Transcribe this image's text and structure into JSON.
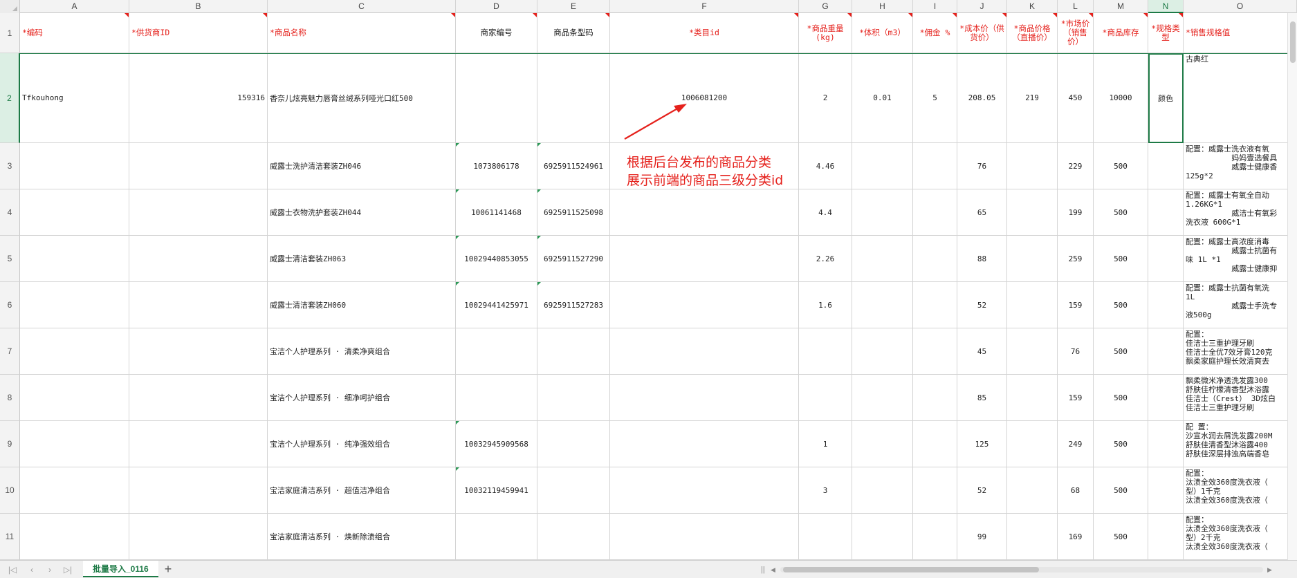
{
  "columns": [
    "A",
    "B",
    "C",
    "D",
    "E",
    "F",
    "G",
    "H",
    "I",
    "J",
    "K",
    "L",
    "M",
    "N",
    "O"
  ],
  "selected_column": "N",
  "selected_row": "2",
  "header_row": {
    "num": "1",
    "A": "*编码",
    "B": "*供货商ID",
    "C": "*商品名称",
    "D": "商家编号",
    "E": "商品条型码",
    "F": "*类目id",
    "G": "*商品重量(kg)",
    "H": "*体积（m3）",
    "I": "*佣金 %",
    "J": "*成本价（供货价）",
    "K": "*商品价格（直播价）",
    "L": "*市场价（销售价）",
    "M": "*商品库存",
    "N": "*规格类型",
    "O": "*销售规格值"
  },
  "rows": [
    {
      "num": "2",
      "A": "Tfkouhong",
      "B": "159316",
      "C": "香奈儿炫亮魅力唇膏丝绒系列哑光口红500",
      "D": "",
      "E": "",
      "F": "1006081200",
      "G": "2",
      "H": "0.01",
      "I": "5",
      "J": "208.05",
      "K": "219",
      "L": "450",
      "M": "10000",
      "N": "颜色",
      "O": "古典红"
    },
    {
      "num": "3",
      "A": "",
      "B": "",
      "C": "威露士洗护清洁套装ZH046",
      "D": "1073806178",
      "E": "6925911524961",
      "F": "",
      "G": "4.46",
      "H": "",
      "I": "",
      "J": "76",
      "K": "",
      "L": "229",
      "M": "500",
      "N": "",
      "O": "配置：威露士洗衣液有氧\n          妈妈壹选餐具\n          威露士健康香\n125g*2"
    },
    {
      "num": "4",
      "A": "",
      "B": "",
      "C": "威露士衣物洗护套装ZH044",
      "D": "10061141468",
      "E": "6925911525098",
      "F": "",
      "G": "4.4",
      "H": "",
      "I": "",
      "J": "65",
      "K": "",
      "L": "199",
      "M": "500",
      "N": "",
      "O": "配置：威露士有氧全自动\n1.26KG*1\n          威洁士有氧彩\n洗衣液 600G*1"
    },
    {
      "num": "5",
      "A": "",
      "B": "",
      "C": "威露士清洁套装ZH063",
      "D": "10029440853055",
      "E": "6925911527290",
      "F": "",
      "G": "2.26",
      "H": "",
      "I": "",
      "J": "88",
      "K": "",
      "L": "259",
      "M": "500",
      "N": "",
      "O": "配置：威露士高浓度消毒\n          威露士抗菌有\n味 1L *1\n          威露士健康抑"
    },
    {
      "num": "6",
      "A": "",
      "B": "",
      "C": "威露士清洁套装ZH060",
      "D": "10029441425971",
      "E": "6925911527283",
      "F": "",
      "G": "1.6",
      "H": "",
      "I": "",
      "J": "52",
      "K": "",
      "L": "159",
      "M": "500",
      "N": "",
      "O": "配置：威露士抗菌有氧洗\n1L\n          威露士手洗专\n液500g"
    },
    {
      "num": "7",
      "A": "",
      "B": "",
      "C": "宝洁个人护理系列 · 清柔净爽组合",
      "D": "",
      "E": "",
      "F": "",
      "G": "",
      "H": "",
      "I": "",
      "J": "45",
      "K": "",
      "L": "76",
      "M": "500",
      "N": "",
      "O": "配置：\n佳洁士三重护理牙刷\n佳洁士全优7效牙膏120克\n飘柔家庭护理长效清爽去"
    },
    {
      "num": "8",
      "A": "",
      "B": "",
      "C": "宝洁个人护理系列 · 细净呵护组合",
      "D": "",
      "E": "",
      "F": "",
      "G": "",
      "H": "",
      "I": "",
      "J": "85",
      "K": "",
      "L": "159",
      "M": "500",
      "N": "",
      "O": "飘柔微米净透洗发露300\n舒肤佳柠檬清香型沐浴露\n佳洁士（Crest） 3D炫白\n佳洁士三重护理牙刷"
    },
    {
      "num": "9",
      "A": "",
      "B": "",
      "C": "宝洁个人护理系列 · 纯净强效组合",
      "D": "10032945909568",
      "E": "",
      "F": "",
      "G": "1",
      "H": "",
      "I": "",
      "J": "125",
      "K": "",
      "L": "249",
      "M": "500",
      "N": "",
      "O": "配 置：\n沙宣水润去屑洗发露200M\n舒肤佳清香型沐浴露400\n舒肤佳深层排浊高端香皂"
    },
    {
      "num": "10",
      "A": "",
      "B": "",
      "C": "宝洁家庭清洁系列 · 超值洁净组合",
      "D": "10032119459941",
      "E": "",
      "F": "",
      "G": "3",
      "H": "",
      "I": "",
      "J": "52",
      "K": "",
      "L": "68",
      "M": "500",
      "N": "",
      "O": "配置：\n汰渍全效360度洗衣液（\n型）1千克\n汰渍全效360度洗衣液（"
    },
    {
      "num": "11",
      "A": "",
      "B": "",
      "C": "宝洁家庭清洁系列 · 焕新除渍组合",
      "D": "",
      "E": "",
      "F": "",
      "G": "",
      "H": "",
      "I": "",
      "J": "99",
      "K": "",
      "L": "169",
      "M": "500",
      "N": "",
      "O": "配置：\n汰渍全效360度洗衣液（\n型）2千克\n汰渍全效360度洗衣液（"
    }
  ],
  "annotation": {
    "line1": "根据后台发布的商品分类",
    "line2": "展示前端的商品三级分类id"
  },
  "sheet_tab": "批量导入_0116",
  "nav_icons": [
    "first-sheet-icon",
    "prev-sheet-icon",
    "next-sheet-icon",
    "last-sheet-icon"
  ],
  "colors": {
    "accent": "#1d7a46",
    "required_red": "#e5211c",
    "grid": "#d4d4d4"
  }
}
